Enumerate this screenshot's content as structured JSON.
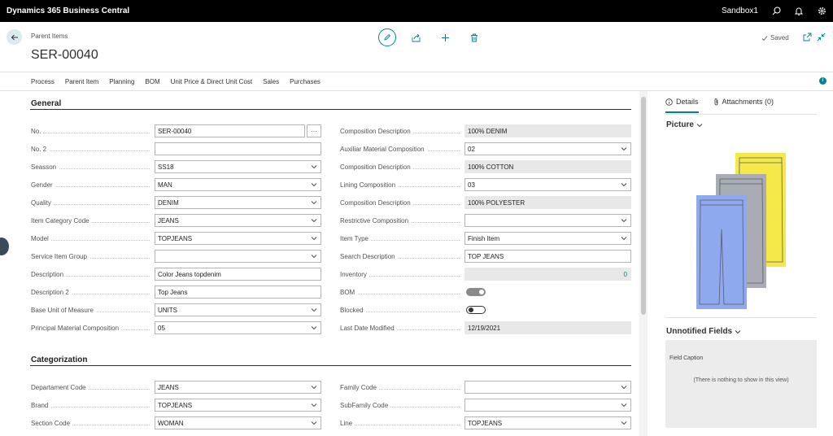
{
  "topbar": {
    "app_name": "Dynamics 365 Business Central",
    "environment": "Sandbox1"
  },
  "header": {
    "breadcrumb": "Parent Items",
    "title": "SER-00040",
    "saved": "Saved"
  },
  "menu": [
    "Process",
    "Parent Item",
    "Planning",
    "BOM",
    "Unit Price & Direct Unit Cost",
    "Sales",
    "Purchases"
  ],
  "general": {
    "title": "General",
    "left": [
      {
        "label": "No.",
        "value": "SER-00040",
        "kind": "text-ellipsis"
      },
      {
        "label": "No. 2",
        "value": "",
        "kind": "text"
      },
      {
        "label": "Seasson",
        "value": "SS18",
        "kind": "select"
      },
      {
        "label": "Gender",
        "value": "MAN",
        "kind": "select"
      },
      {
        "label": "Quality",
        "value": "DENIM",
        "kind": "select"
      },
      {
        "label": "Item Category Code",
        "value": "JEANS",
        "kind": "select"
      },
      {
        "label": "Model",
        "value": "TOPJEANS",
        "kind": "select"
      },
      {
        "label": "Service Item Group",
        "value": "",
        "kind": "select"
      },
      {
        "label": "Description",
        "value": "Color Jeans topdenim",
        "kind": "text"
      },
      {
        "label": "Description 2",
        "value": "Top Jeans",
        "kind": "text"
      },
      {
        "label": "Base Unit of Measure",
        "value": "UNITS",
        "kind": "select"
      },
      {
        "label": "Principal Material Composition",
        "value": "05",
        "kind": "select"
      }
    ],
    "right": [
      {
        "label": "Composition Description",
        "value": "100% DENIM",
        "kind": "readonly"
      },
      {
        "label": "Auxiliar Material Composition",
        "value": "02",
        "kind": "select"
      },
      {
        "label": "Composition Description",
        "value": "100% COTTON",
        "kind": "readonly"
      },
      {
        "label": "Lining Composition",
        "value": "03",
        "kind": "select"
      },
      {
        "label": "Composition Description",
        "value": "100% POLYESTER",
        "kind": "readonly"
      },
      {
        "label": "Restrictive Composition",
        "value": "",
        "kind": "select"
      },
      {
        "label": "Item Type",
        "value": "Finish Item",
        "kind": "select"
      },
      {
        "label": "Search Description",
        "value": "TOP JEANS",
        "kind": "text"
      },
      {
        "label": "Inventory",
        "value": "0",
        "kind": "readonly-num"
      },
      {
        "label": "BOM",
        "value": "on",
        "kind": "toggle-on"
      },
      {
        "label": "Blocked",
        "value": "off",
        "kind": "toggle-off"
      },
      {
        "label": "Last Date Modified",
        "value": "12/19/2021",
        "kind": "readonly"
      }
    ]
  },
  "categorization": {
    "title": "Categorization",
    "left": [
      {
        "label": "Departament Code",
        "value": "JEANS",
        "kind": "select"
      },
      {
        "label": "Brand",
        "value": "TOPJEANS",
        "kind": "select"
      },
      {
        "label": "Section Code",
        "value": "WOMAN",
        "kind": "select"
      }
    ],
    "right": [
      {
        "label": "Family Code",
        "value": "",
        "kind": "select"
      },
      {
        "label": "SubFamily Code",
        "value": "",
        "kind": "select"
      },
      {
        "label": "Line",
        "value": "TOPJEANS",
        "kind": "select"
      }
    ]
  },
  "factbox": {
    "tab_details": "Details",
    "tab_attachments": "Attachments (0)",
    "picture_title": "Picture",
    "unnotified_title": "Unnotified Fields",
    "field_caption": "Field Caption",
    "empty_text": "(There is nothing to show in this view)"
  },
  "colors": {
    "accent": "#008489",
    "pants_yellow": "#f5e94a",
    "pants_gray": "#a9acb5",
    "pants_blue": "#8ea9ee"
  }
}
